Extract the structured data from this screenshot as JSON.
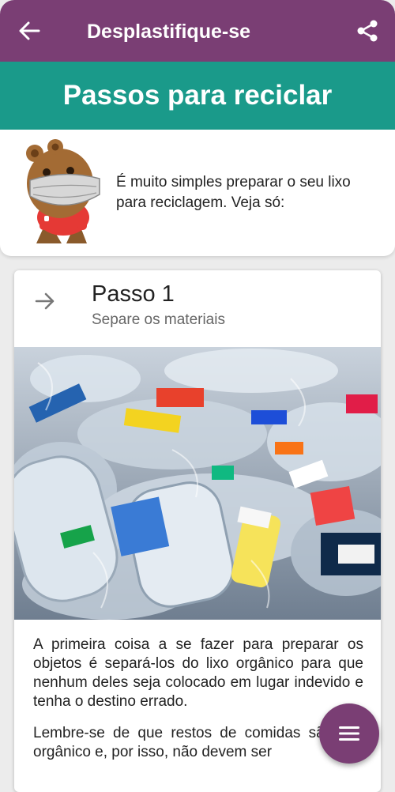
{
  "appbar": {
    "title": "Desplastifique-se",
    "back_icon": "arrow-left-icon",
    "share_icon": "share-icon"
  },
  "banner": {
    "title": "Passos para reciclar"
  },
  "intro": {
    "text": "É muito simples preparar o seu lixo para reciclagem. Veja só:",
    "mascot": "masked-mascot"
  },
  "step": {
    "icon": "arrow-right-icon",
    "title": "Passo 1",
    "subtitle": "Separe os materiais",
    "image": "plastic-bottles-photo",
    "paragraph1": "A primeira coisa a se fazer para preparar os objetos é separá-los do lixo orgânico para que nenhum deles seja colocado em lugar indevido e tenha o destino errado.",
    "paragraph2": "Lembre-se de que restos de comidas são lixo orgânico e, por isso, não devem ser"
  },
  "fab": {
    "icon": "menu-icon"
  },
  "colors": {
    "appbar": "#7a3e74",
    "banner": "#1a9a8a",
    "fab": "#7a3e74"
  }
}
